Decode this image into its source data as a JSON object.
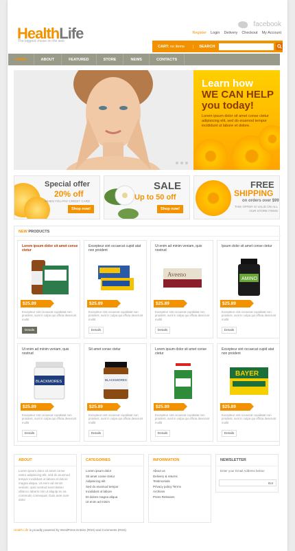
{
  "brand": {
    "part1": "Health",
    "part2": "Life",
    "tagline": "The biggest choise on the web"
  },
  "social": {
    "twitter_icon": "twitter-bird-icon",
    "facebook": "facebook"
  },
  "toplinks": [
    "Register",
    "Login",
    "Delivery",
    "Checkout",
    "My Account"
  ],
  "cart": {
    "label": "CART:",
    "count": "no items",
    "search_label": "SEARCH",
    "search_value": ""
  },
  "nav": [
    "HOME",
    "ABOUT",
    "FEATURED",
    "STORE",
    "NEWS",
    "CONTACTS"
  ],
  "hero": {
    "line1": "Learn how",
    "line2": "WE CAN HELP",
    "line3": "you today!",
    "text": "Lorem ipsum dolor sit amet conse ctetur adipisicing elit, sed do eiusmod tempor incididunt ut labore et dolore."
  },
  "banners": [
    {
      "title": "Special offer",
      "offer": "20% off",
      "sub": "WHEN YOU PAY CREDIT CARD",
      "button": "Shop now!"
    },
    {
      "title": "SALE",
      "offer": "Up to 50 off",
      "button": "Shop now!"
    },
    {
      "title": "FREE",
      "offer": "SHIPPING",
      "sub2": "on orders over $99",
      "sub": "THIS OFFER IS VALID ON ALL OUR STORE ITEMS"
    }
  ],
  "products_heading": {
    "a": "NEW",
    "b": " PRODUCTS"
  },
  "products": [
    {
      "name": "Lorem ipsum dolor sit amet conse ctetur",
      "price": "$25.89",
      "desc": "Excepteur sint occaecat cupidatat non proident, sunt in culpa qui officia deserunt mollit",
      "button": "Details"
    },
    {
      "name": "Excepteur sint occaecat cupid atat non proident",
      "price": "$25.89",
      "desc": "Excepteur sint occaecat cupidatat non proident, sunt in culpa qui officia deserunt mollit",
      "button": "Details"
    },
    {
      "name": "Ut enim ad minim veniam, quis nostrud",
      "price": "$25.89",
      "desc": "Excepteur sint occaecat cupidatat non proident, sunt in culpa qui officia deserunt mollit",
      "button": "Details"
    },
    {
      "name": "Ipsum dolor sit amet conse ctetur",
      "price": "$25.89",
      "desc": "Excepteur sint occaecat cupidatat non proident, sunt in culpa qui officia deserunt mollit",
      "button": "Details"
    },
    {
      "name": "Ut enim ad minim veniam, quis nostrud",
      "price": "$25.89",
      "desc": "Excepteur sint occaecat cupidatat non proident, sunt in culpa qui officia deserunt mollit",
      "button": "Details"
    },
    {
      "name": "Sit amet conse ctetur",
      "price": "$25.89",
      "desc": "Excepteur sint occaecat cupidatat non proident, sunt in culpa qui officia deserunt mollit",
      "button": "Details"
    },
    {
      "name": "Lorem ipsum dolor sit amet conse ctetur",
      "price": "$25.89",
      "desc": "Excepteur sint occaecat cupidatat non proident, sunt in culpa qui officia deserunt mollit",
      "button": "Details"
    },
    {
      "name": "Excepteur sint occaecat cupid atat non proident",
      "price": "$25.89",
      "desc": "Excepteur sint occaecat cupidatat non proident, sunt in culpa qui officia deserunt mollit",
      "button": "Details"
    }
  ],
  "footer": {
    "about": {
      "heading": "ABOUT",
      "text": "Lorem ipsum dolor sit amet conse ctetur adipisicing elit, sed do eiusmod tempor incididunt ut labore et dolore magna aliqua. Ut enim ad minim veniam, quis nostrud exercitation ullamco laboris nisi ut aliquip ex ea commodo consequat. Duis aute irure dolor"
    },
    "categories": {
      "heading": "CATEGORIES",
      "items": [
        "Lorem ipsum dolor",
        "Sit amet conse ctetur",
        "Adipisicing elit",
        "Sed do eiusmod tempor",
        "Incididunt ut labore",
        "Et dolore magna aliqua",
        "Ut enim ad minim"
      ]
    },
    "information": {
      "heading": "INFORMATION",
      "items": [
        "About us",
        "Delivery & returns",
        "Testimonials",
        "Privacy policy Terms",
        "Archives",
        "Press Releases"
      ]
    },
    "newsletter": {
      "heading": "NEWSLETTER",
      "label": "Enter your Email Address below:",
      "button": "Go!"
    }
  },
  "copyright": {
    "brand": "Health Life",
    "text": " is proudly powered by WordPress Entries (RSS) and Comments (RSS)"
  },
  "colors": {
    "accent": "#f39200",
    "nav": "#9a9a88"
  }
}
